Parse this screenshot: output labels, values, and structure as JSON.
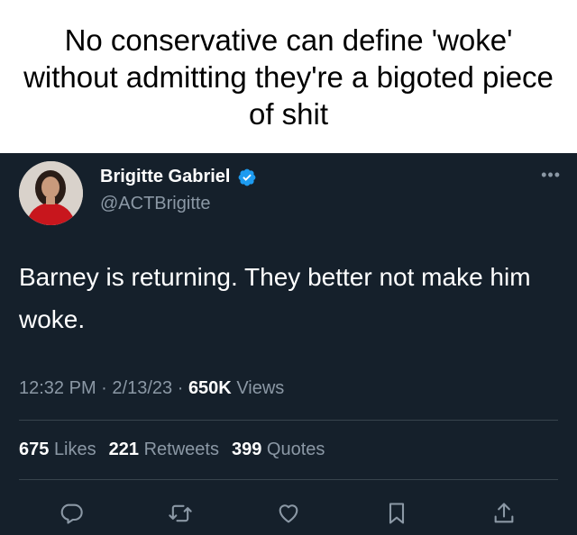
{
  "meme": {
    "caption": "No conservative can define 'woke' without admitting they're a bigoted piece of shit"
  },
  "tweet": {
    "author_name": "Brigitte Gabriel",
    "handle": "@ACTBrigitte",
    "more_label": "•••",
    "text": "Barney is returning. They better not make him woke.",
    "time": "12:32 PM",
    "date": "2/13/23",
    "separator": "·",
    "views_count": "650K",
    "views_label": "Views",
    "likes_count": "675",
    "likes_label": "Likes",
    "retweets_count": "221",
    "retweets_label": "Retweets",
    "quotes_count": "399",
    "quotes_label": "Quotes"
  },
  "colors": {
    "background": "#15202b",
    "secondary_text": "#8b98a5",
    "verified_badge": "#1d9bf0",
    "divider": "#38444d"
  },
  "icons": [
    "verified-badge-icon",
    "more-icon",
    "reply-icon",
    "retweet-icon",
    "like-icon",
    "bookmark-icon",
    "share-icon"
  ]
}
